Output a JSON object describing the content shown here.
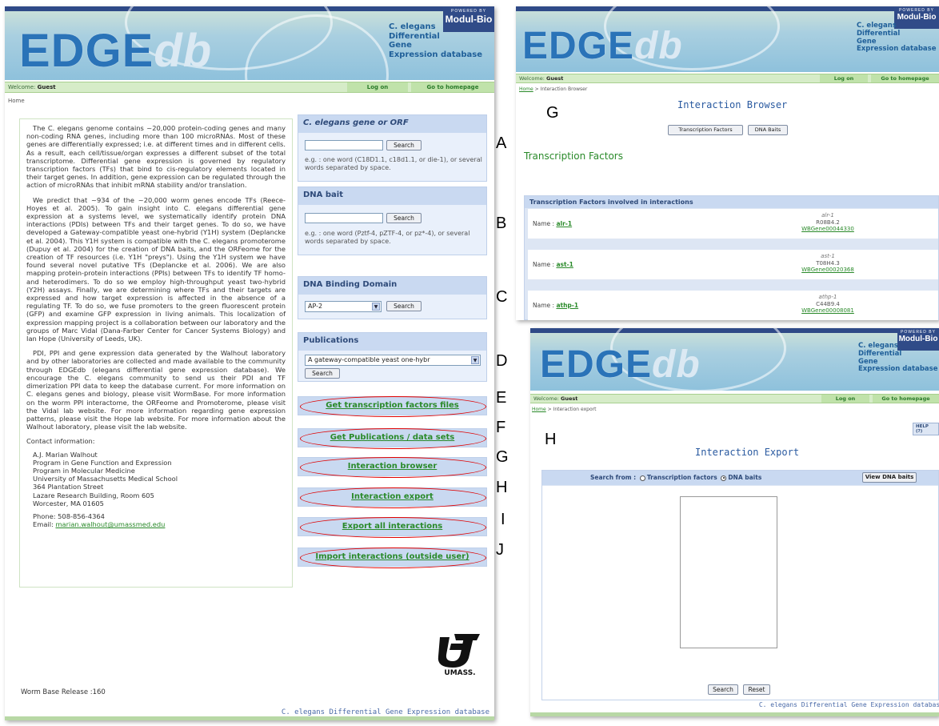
{
  "brand": {
    "logo_main": "EDGE",
    "logo_sub": "db",
    "powered_by": "POWERED BY",
    "powered_name": "Modul-Bio",
    "tagline": {
      "l1": "C. elegans",
      "l2": "Differential",
      "l3": "Gene",
      "l4": "Expression database"
    }
  },
  "main": {
    "welcome_label": "Welcome:",
    "welcome_user": "Guest",
    "nav_logon": "Log on",
    "nav_home": "Go to homepage",
    "breadcrumb": "Home",
    "intro_p1": "The C. elegans genome contains ~20,000 protein-coding genes and many non-coding RNA genes, including more than 100 microRNAs. Most of these genes are differentially expressed; i.e. at different times and in different cells. As a result, each cell/tissue/organ expresses a different subset of the total transcriptome. Differential gene expression is governed by regulatory transcription factors (TFs) that bind to cis-regulatory elements located in their target genes. In addition, gene expression can be regulated through the action of microRNAs that inhibit mRNA stability and/or translation.",
    "intro_p2": "We predict that ~934 of the ~20,000 worm genes encode TFs (Reece-Hoyes et al. 2005). To gain insight into C. elegans differential gene expression at a systems level, we systematically identify protein DNA interactions (PDIs) between TFs and their target genes. To do so, we have developed a Gateway-compatible yeast one-hybrid (Y1H) system (Deplancke et al. 2004). This Y1H system is compatible with the C. elegans promoterome (Dupuy et al. 2004) for the creation of DNA baits, and the ORFeome for the creation of TF resources (i.e. Y1H \"preys\"). Using the Y1H system we have found several novel putative TFs (Deplancke et al. 2006). We are also mapping protein-protein interactions (PPIs) between TFs to identify TF homo- and heterodimers. To do so we employ high-throughput yeast two-hybrid (Y2H) assays. Finally, we are determining where TFs and their targets are expressed and how target expression is affected in the absence of a regulating TF. To do so, we fuse promoters to the green fluorescent protein (GFP) and examine GFP expression in living animals. This localization of expression mapping project is a collaboration between our laboratory and the groups of Marc Vidal (Dana-Farber Center for Cancer Systems Biology) and Ian Hope (University of Leeds, UK).",
    "intro_p3": "PDI, PPI and gene expression data generated by the Walhout laboratory and by other laboratories are collected and made available to the community through EDGEdb (elegans differential gene expression database). We encourage the C. elegans community to send us their PDI and TF dimerization PPI data to keep the database current. For more information on C. elegans genes and biology, please visit WormBase. For more information on the worm PPI interactome, the ORFeome and Promoterome, please visit the Vidal lab website. For more information regarding gene expression patterns, please visit the Hope lab website. For more information about the Walhout laboratory, please visit the lab website.",
    "contact_title": "Contact information:",
    "contact_lines": [
      "A.J. Marian Walhout",
      "Program in Gene Function and Expression",
      "Program in Molecular Medicine",
      "University of Massachusetts Medical School",
      "364 Plantation Street",
      "Lazare Research Building, Room 605",
      "Worcester, MA 01605"
    ],
    "phone": "Phone: 508-856-4364",
    "email_label": "Email:",
    "email": "marian.walhout@umassmed.edu",
    "release": "Worm Base Release :160",
    "footer": "C. elegans Differential Gene Expression database",
    "umass": "UMASS.",
    "search_gene": {
      "title": "C. elegans gene or ORF",
      "button": "Search",
      "hint": "e.g. : one word (C18D1.1, c18d1.1, or die-1), or several words separated by space."
    },
    "dna_bait": {
      "title": "DNA bait",
      "button": "Search",
      "hint": "e.g. : one word (Pztf-4, pZTF-4, or pz*-4), or several words separated by space."
    },
    "dbd": {
      "title": "DNA Binding Domain",
      "selected": "AP-2",
      "button": "Search"
    },
    "pubs": {
      "title": "Publications",
      "selected": "A gateway-compatible yeast one-hybr",
      "button": "Search"
    },
    "nav_buttons": [
      "Get transcription factors files",
      "Get Publications / data sets",
      "Interaction browser",
      "Interaction export",
      "Export all interactions",
      "Import interactions (outside user)"
    ],
    "letters": [
      "A",
      "B",
      "C",
      "D",
      "E",
      "F",
      "G",
      "H",
      "I",
      "J"
    ]
  },
  "browser": {
    "letter": "G",
    "welcome_label": "Welcome:",
    "welcome_user": "Guest",
    "nav_logon": "Log on",
    "nav_home": "Go to homepage",
    "crumb_home": "Home",
    "crumb_rest": " > Interaction Browser",
    "title": "Interaction Browser",
    "btn_tf": "Transcription Factors",
    "btn_dna": "DNA Baits",
    "section": "Transcription Factors",
    "table_header": "Transcription Factors involved in interactions",
    "name_label": "Name :",
    "rows": [
      {
        "name": "alr-1",
        "gene": "alr-1",
        "orf": "R08B4.2",
        "wb": "WBGene00044330"
      },
      {
        "name": "ast-1",
        "gene": "ast-1",
        "orf": "T08H4.3",
        "wb": "WBGene00020368"
      },
      {
        "name": "athp-1",
        "gene": "athp-1",
        "orf": "C44B9.4",
        "wb": "WBGene00008081"
      }
    ]
  },
  "export": {
    "letter": "H",
    "welcome_label": "Welcome:",
    "welcome_user": "Guest",
    "nav_logon": "Log on",
    "nav_home": "Go to homepage",
    "crumb_home": "Home",
    "crumb_rest": " > Interaction export",
    "help": "HELP (?)",
    "title": "Interaction Export",
    "search_from": "Search from :",
    "opt_tf": "Transcription factors",
    "opt_dna": "DNA baits",
    "view_btn": "View DNA baits",
    "btn_search": "Search",
    "btn_reset": "Reset",
    "footer": "C. elegans Differential Gene Expression database"
  }
}
